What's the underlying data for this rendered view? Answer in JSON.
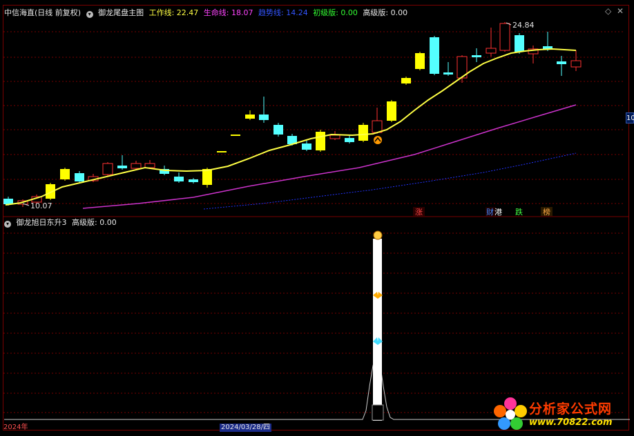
{
  "main_header": {
    "stock": "中信海直(日线 前复权)",
    "indicator": "御龙尾盘主图",
    "work_line": "工作线: 22.47",
    "life_line": "生命线: 18.07",
    "trend_line": "趋势线: 14.24",
    "basic": "初级版: 0.00",
    "advanced": "高级版: 0.00"
  },
  "sub_header": {
    "indicator": "御龙旭日东升3",
    "advanced": "高级版: 0.00"
  },
  "price_labels": {
    "high": "24.84",
    "low": "10.07"
  },
  "signal_labels": [
    "涨",
    "财",
    "港",
    "跌",
    "榜"
  ],
  "footer": {
    "year": "2024年",
    "cursor_date": "2024/03/28/四"
  },
  "scale_tag": "10",
  "logo": {
    "name": "分析家公式网",
    "url": "www.70822.com"
  },
  "colors": {
    "up_candle": "#ff3232",
    "down_candle": "#54ffff",
    "yellow_candle": "#ffff00",
    "work_line": "#ffff44",
    "life_line": "#cc33cc",
    "trend_line": "#3344ff",
    "grid": "#7a0000"
  }
}
